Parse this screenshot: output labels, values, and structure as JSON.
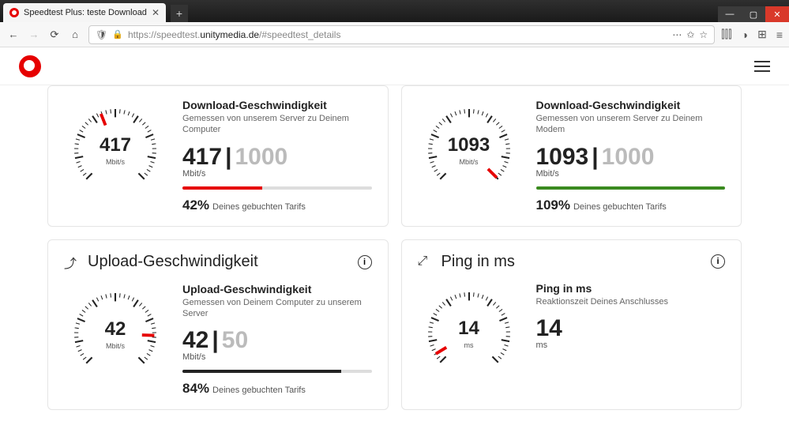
{
  "browser": {
    "tab_title": "Speedtest Plus: teste Download",
    "url_prefix": "https://speedtest.",
    "url_host": "unitymedia.de",
    "url_path": "/#speedtest_details"
  },
  "sections": {
    "upload": {
      "title": "Upload-Geschwindigkeit"
    },
    "ping": {
      "title": "Ping in ms"
    }
  },
  "gauges": {
    "dl_computer": {
      "title": "Download-Geschwindigkeit",
      "subtitle": "Gemessen von unserem Server zu Deinem Computer",
      "value": "417",
      "max": "1000",
      "unit": "Mbit/s",
      "percent": "42%",
      "percent_of": "Deines gebuchten Tarifs",
      "bar_color": "#e60000",
      "bar_width": "42%",
      "gauge_value": "417",
      "gauge_unit": "Mbit/s"
    },
    "dl_modem": {
      "title": "Download-Geschwindigkeit",
      "subtitle": "Gemessen von unserem Server zu Deinem Modem",
      "value": "1093",
      "max": "1000",
      "unit": "Mbit/s",
      "percent": "109%",
      "percent_of": "Deines gebuchten Tarifs",
      "bar_color": "#3a8a1f",
      "bar_width": "100%",
      "gauge_value": "1093",
      "gauge_unit": "Mbit/s"
    },
    "upload": {
      "title": "Upload-Geschwindigkeit",
      "subtitle": "Gemessen von Deinem Computer zu unserem Server",
      "value": "42",
      "max": "50",
      "unit": "Mbit/s",
      "percent": "84%",
      "percent_of": "Deines gebuchten Tarifs",
      "bar_color": "#222",
      "bar_width": "84%",
      "gauge_value": "42",
      "gauge_unit": "Mbit/s"
    },
    "ping": {
      "title": "Ping in ms",
      "subtitle": "Reaktionszeit Deines Anschlusses",
      "value": "14",
      "unit": "ms",
      "gauge_value": "14",
      "gauge_unit": "ms"
    }
  },
  "chart_data": [
    {
      "type": "gauge",
      "label": "Download (Computer)",
      "value": 417,
      "max": 1000,
      "unit": "Mbit/s",
      "percent_of_plan": 42
    },
    {
      "type": "gauge",
      "label": "Download (Modem)",
      "value": 1093,
      "max": 1000,
      "unit": "Mbit/s",
      "percent_of_plan": 109
    },
    {
      "type": "gauge",
      "label": "Upload",
      "value": 42,
      "max": 50,
      "unit": "Mbit/s",
      "percent_of_plan": 84
    },
    {
      "type": "gauge",
      "label": "Ping",
      "value": 14,
      "unit": "ms"
    }
  ]
}
